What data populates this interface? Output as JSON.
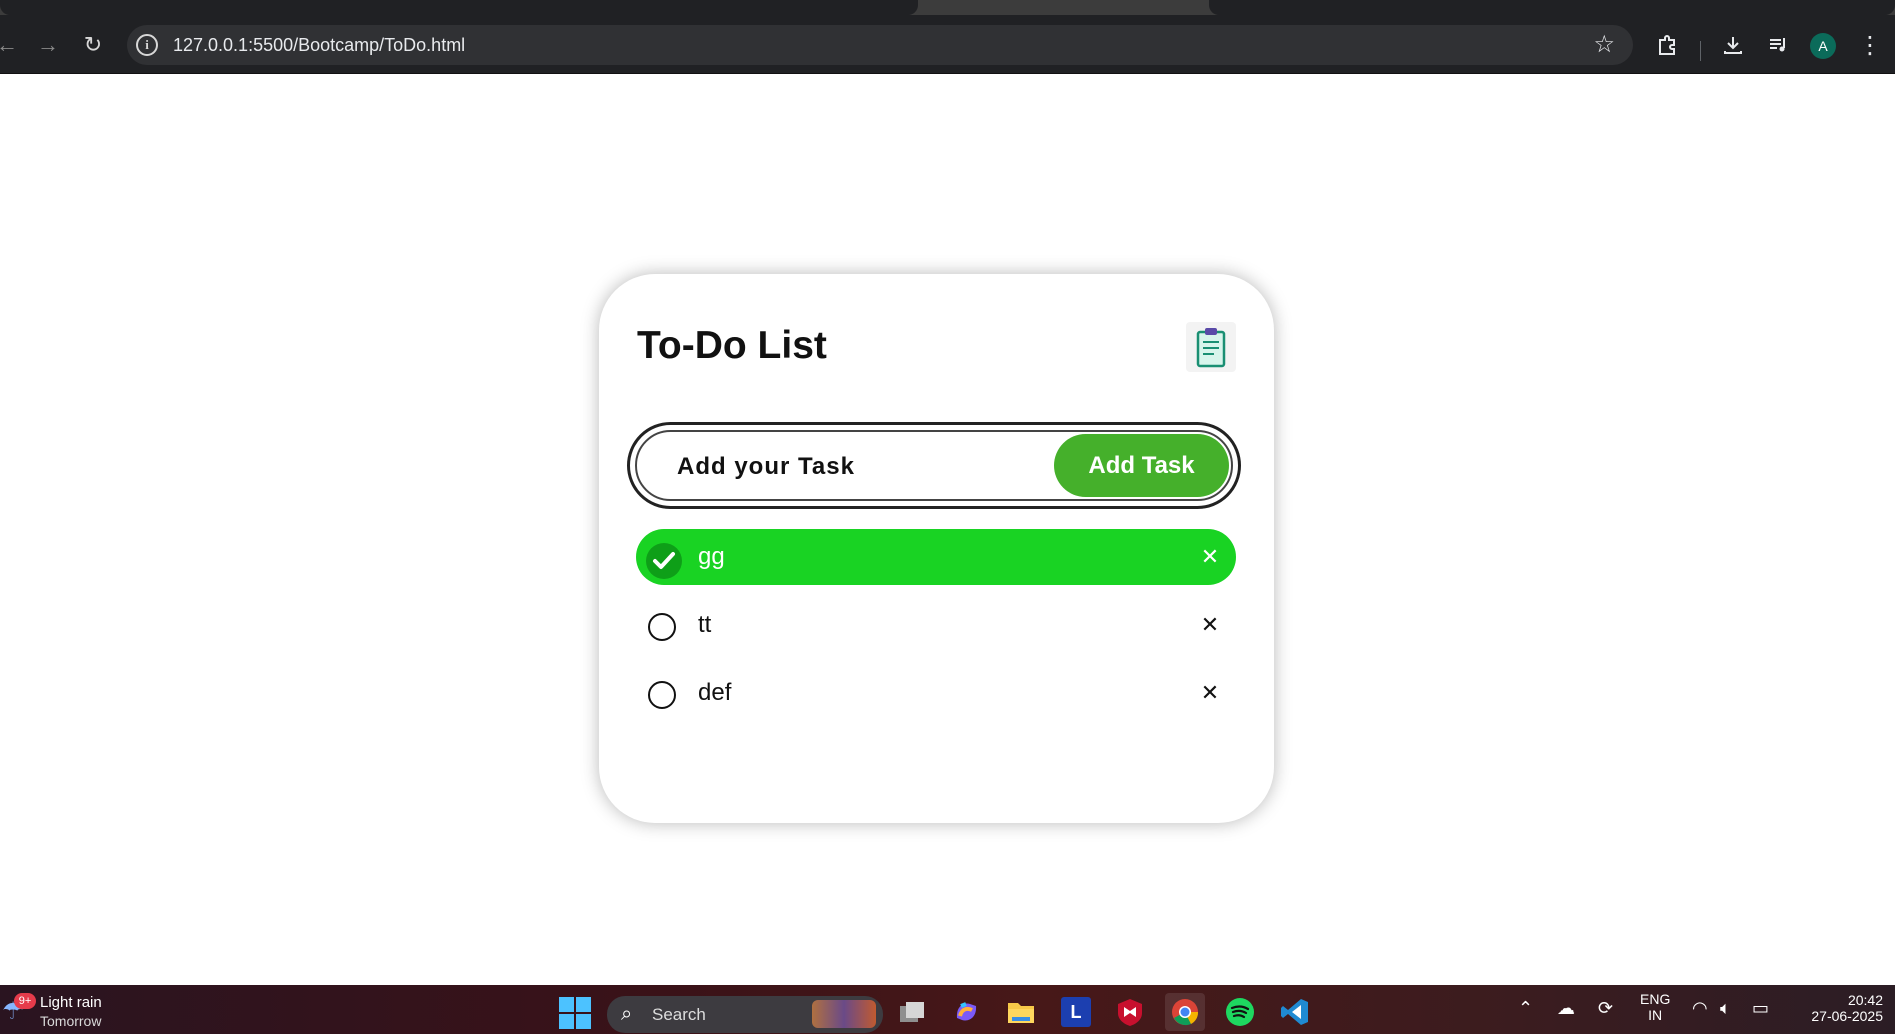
{
  "browser": {
    "url": "127.0.0.1:5500/Bootcamp/ToDo.html",
    "profile_initial": "A",
    "icons": [
      "back-icon",
      "forward-icon",
      "reload-icon",
      "info-icon",
      "bookmark-star-icon",
      "extensions-icon",
      "download-icon",
      "media-icon",
      "menu-icon"
    ]
  },
  "app": {
    "title": "To-Do List",
    "title_icon": "clipboard-icon",
    "input_placeholder": "Add your Task",
    "add_button": "Add Task",
    "tasks": [
      {
        "text": "gg",
        "done": true
      },
      {
        "text": "tt",
        "done": false
      },
      {
        "text": "def",
        "done": false
      }
    ],
    "remove_glyph": "✕",
    "colors": {
      "accent": "#45b02b",
      "done_row": "#19d323",
      "done_check": "#0e9f18"
    }
  },
  "taskbar": {
    "weather_badge": "9+",
    "weather_main": "Light rain",
    "weather_sub": "Tomorrow",
    "search_label": "Search",
    "apps": [
      "windows-start-icon",
      "task-view-icon",
      "copilot-icon",
      "file-explorer-icon",
      "l-app-icon",
      "mcafee-icon",
      "chrome-icon",
      "spotify-icon",
      "vscode-icon"
    ],
    "lang_line1": "ENG",
    "lang_line2": "IN",
    "time": "20:42",
    "date": "27-06-2025"
  }
}
